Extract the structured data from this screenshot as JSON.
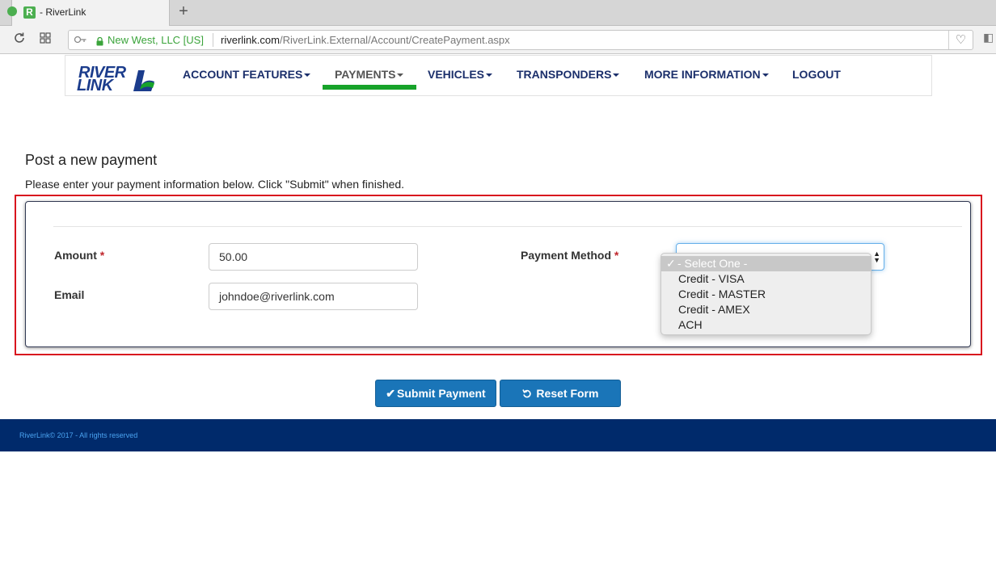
{
  "browser": {
    "tab_title": "- RiverLink",
    "tab_favicon": "R",
    "new_tab": "+",
    "site_identity": "New West, LLC [US]",
    "url_host": "riverlink.com",
    "url_path": "/RiverLink.External/Account/CreatePayment.aspx",
    "icons": [
      "reload-icon",
      "grid-icon",
      "key-icon",
      "lock-icon",
      "heart-icon"
    ]
  },
  "header": {
    "logo_line1": "RIVER",
    "logo_line2": "LINK",
    "menu": [
      {
        "label": "ACCOUNT FEATURES",
        "dropdown": true
      },
      {
        "label": "PAYMENTS",
        "dropdown": true,
        "active": true
      },
      {
        "label": "VEHICLES",
        "dropdown": true
      },
      {
        "label": "TRANSPONDERS",
        "dropdown": true
      },
      {
        "label": "MORE INFORMATION",
        "dropdown": true
      },
      {
        "label": "LOGOUT",
        "dropdown": false
      }
    ],
    "active_color": "#17a32a",
    "menu_color": "#1b2f6b"
  },
  "main": {
    "title": "Post a new payment",
    "instructions": "Please enter your payment information below. Click \"Submit\" when finished."
  },
  "form": {
    "amount_label": "Amount",
    "amount_value": "50.00",
    "email_label": "Email",
    "email_value": "johndoe@riverlink.com",
    "payment_method_label": "Payment Method",
    "required_marker": "*",
    "payment_method_options": [
      "- Select One -",
      "Credit - VISA",
      "Credit - MASTER",
      "Credit - AMEX",
      "ACH"
    ],
    "selected_option": "- Select One -"
  },
  "buttons": {
    "submit_label": "Submit Payment",
    "reset_label": "Reset Form",
    "color": "#1a75b8"
  },
  "footer": {
    "text": "RiverLink© 2017 - All rights reserved",
    "background": "#002a6b"
  }
}
